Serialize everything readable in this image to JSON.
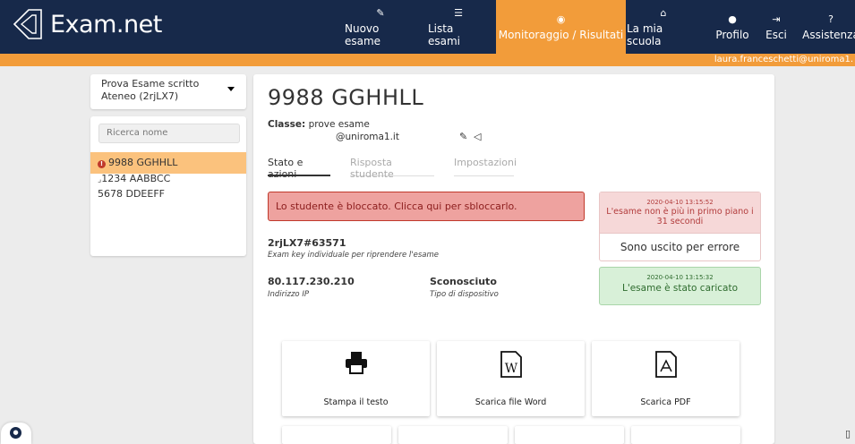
{
  "brand": {
    "name": "Exam.net"
  },
  "nav": [
    {
      "label": "Nuovo esame",
      "icon": "pencil-icon"
    },
    {
      "label": "Lista esami",
      "icon": "list-icon"
    },
    {
      "label": "Monitoraggio / Risultati",
      "icon": "eye-icon"
    },
    {
      "label": "La mia scuola",
      "icon": "home-icon"
    },
    {
      "label": "Profilo",
      "icon": "user-icon"
    },
    {
      "label": "Esci",
      "icon": "sign-out-icon"
    },
    {
      "label": "Assistenza",
      "icon": "question-circle-icon"
    }
  ],
  "active_nav": "Monitoraggio / Risultati",
  "user_email": "laura.franceschetti@uniroma1.",
  "exam_select": {
    "value": "Prova Esame scritto Ateneo (2rjLX7)"
  },
  "search": {
    "placeholder": "Ricerca nome"
  },
  "students": [
    {
      "name": "9988 GGHHLL",
      "status": "blocked",
      "selected": true
    },
    {
      "name": "1234 AABBCC",
      "status": "submitted",
      "selected": false
    },
    {
      "name": "5678 DDEEFF",
      "status": "",
      "selected": false
    }
  ],
  "student": {
    "name": "9988 GGHHLL",
    "class_label": "Classe:",
    "class_value": "prove esame",
    "email": "@uniroma1.it"
  },
  "tabs": [
    "Stato e azioni",
    "Risposta studente",
    "Impostazioni"
  ],
  "active_tab": "Stato e azioni",
  "blocked_message": "Lo studente è bloccato. Clicca qui per sbloccarlo.",
  "events": [
    {
      "time": "2020-04-10 13:15:52",
      "message": "L'esame non è più in primo piano i 31 secondi",
      "action": "Sono uscito per errore",
      "type": "danger"
    },
    {
      "time": "2020-04-10 13:15:32",
      "message": "L'esame è stato caricato",
      "type": "success"
    }
  ],
  "exam_key": {
    "value": "2rjLX7#63571",
    "desc": "Exam key individuale per riprendere l'esame"
  },
  "ip": {
    "value": "80.117.230.210",
    "desc": "Indirizzo IP"
  },
  "device": {
    "value": "Sconosciuto",
    "desc": "Tipo di dispositivo"
  },
  "actions": [
    {
      "label": "Stampa il testo",
      "icon": "print-icon"
    },
    {
      "label": "Scarica file Word",
      "icon": "word-file-icon"
    },
    {
      "label": "Scarica PDF",
      "icon": "pdf-file-icon"
    }
  ],
  "colors": {
    "navy": "#17294a",
    "orange": "#f29c3a",
    "selected": "#fbc27d",
    "danger": "#eea29f",
    "success": "#d8f0d8"
  }
}
